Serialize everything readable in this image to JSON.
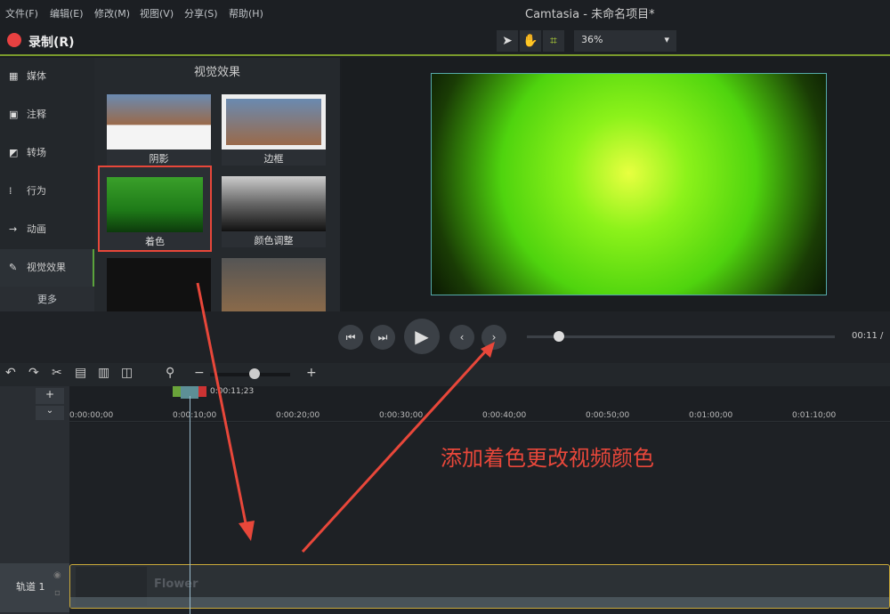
{
  "menu": [
    "文件(F)",
    "编辑(E)",
    "修改(M)",
    "视图(V)",
    "分享(S)",
    "帮助(H)"
  ],
  "title": "Camtasia - 未命名项目*",
  "record_label": "录制(R)",
  "zoom_level": "36%",
  "sidebar": {
    "items": [
      {
        "label": "媒体",
        "icon": "▦"
      },
      {
        "label": "注释",
        "icon": "▣"
      },
      {
        "label": "转场",
        "icon": "◩"
      },
      {
        "label": "行为",
        "icon": "⁞"
      },
      {
        "label": "动画",
        "icon": "→"
      },
      {
        "label": "视觉效果",
        "icon": "✎"
      }
    ],
    "more": "更多"
  },
  "effects": {
    "title": "视觉效果",
    "items": [
      "阴影",
      "边框",
      "着色",
      "颜色调整"
    ]
  },
  "timecode": "00:11 /",
  "playhead_time": "0:00:11;23",
  "ruler": [
    "0:00:00;00",
    "0:00:10;00",
    "0:00:20;00",
    "0:00:30;00",
    "0:00:40;00",
    "0:00:50;00",
    "0:01:00;00",
    "0:01:10;00"
  ],
  "track": {
    "label": "轨道 1",
    "clip": "Flower"
  },
  "annotation": "添加着色更改视频颜色",
  "colors": {
    "accent": "#7a9a2c",
    "record": "#e84141",
    "highlight": "#e8473a"
  }
}
